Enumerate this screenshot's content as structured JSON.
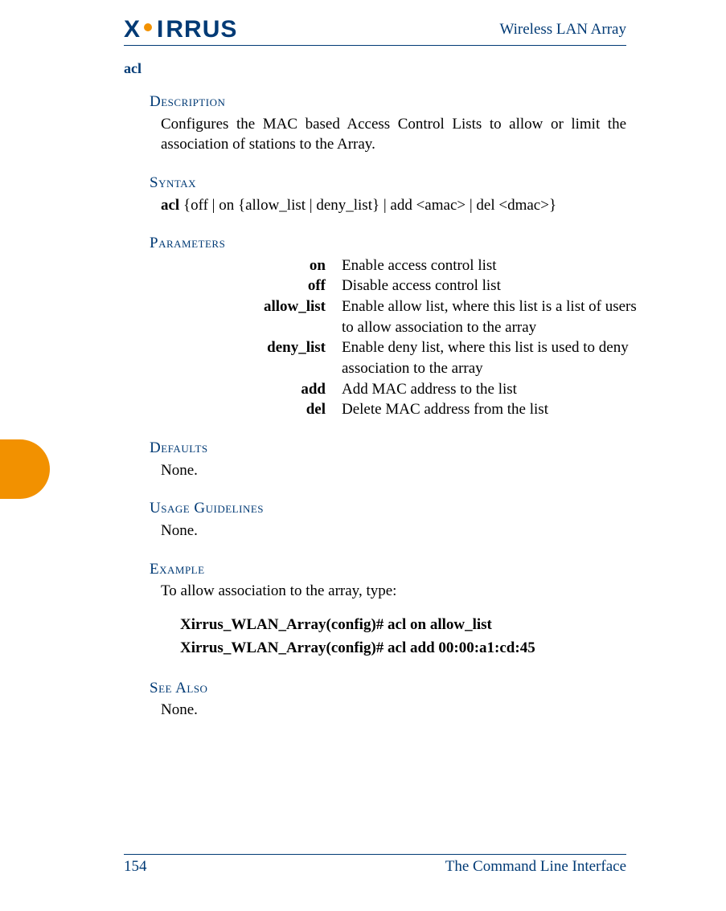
{
  "header": {
    "logo_text": "XIRRUS",
    "product": "Wireless LAN Array"
  },
  "command": "acl",
  "sections": {
    "description": {
      "heading": "Description",
      "text": "Configures the MAC based Access Control Lists to allow or limit the association of stations to the Array."
    },
    "syntax": {
      "heading": "Syntax",
      "kw": "acl",
      "rest": " {off | on {allow_list | deny_list} | add <amac> | del <dmac>}"
    },
    "parameters": {
      "heading": "Parameters",
      "rows": [
        {
          "name": "on",
          "desc": "Enable access control list"
        },
        {
          "name": "off",
          "desc": "Disable access control list"
        },
        {
          "name": "allow_list",
          "desc": "Enable allow list, where this list is a list of users to allow association to the array"
        },
        {
          "name": "deny_list",
          "desc": "Enable deny list, where this list is used to deny association to the array"
        },
        {
          "name": "add",
          "desc": "Add MAC address to the list"
        },
        {
          "name": "del",
          "desc": "Delete MAC address from the list"
        }
      ]
    },
    "defaults": {
      "heading": "Defaults",
      "text": "None."
    },
    "usage": {
      "heading": "Usage Guidelines",
      "text": "None."
    },
    "example": {
      "heading": "Example",
      "intro": "To allow association to the array, type:",
      "lines": [
        "Xirrus_WLAN_Array(config)# acl on allow_list",
        "Xirrus_WLAN_Array(config)# acl add 00:00:a1:cd:45"
      ]
    },
    "see_also": {
      "heading": "See Also",
      "text": "None."
    }
  },
  "footer": {
    "page": "154",
    "chapter": "The Command Line Interface"
  }
}
